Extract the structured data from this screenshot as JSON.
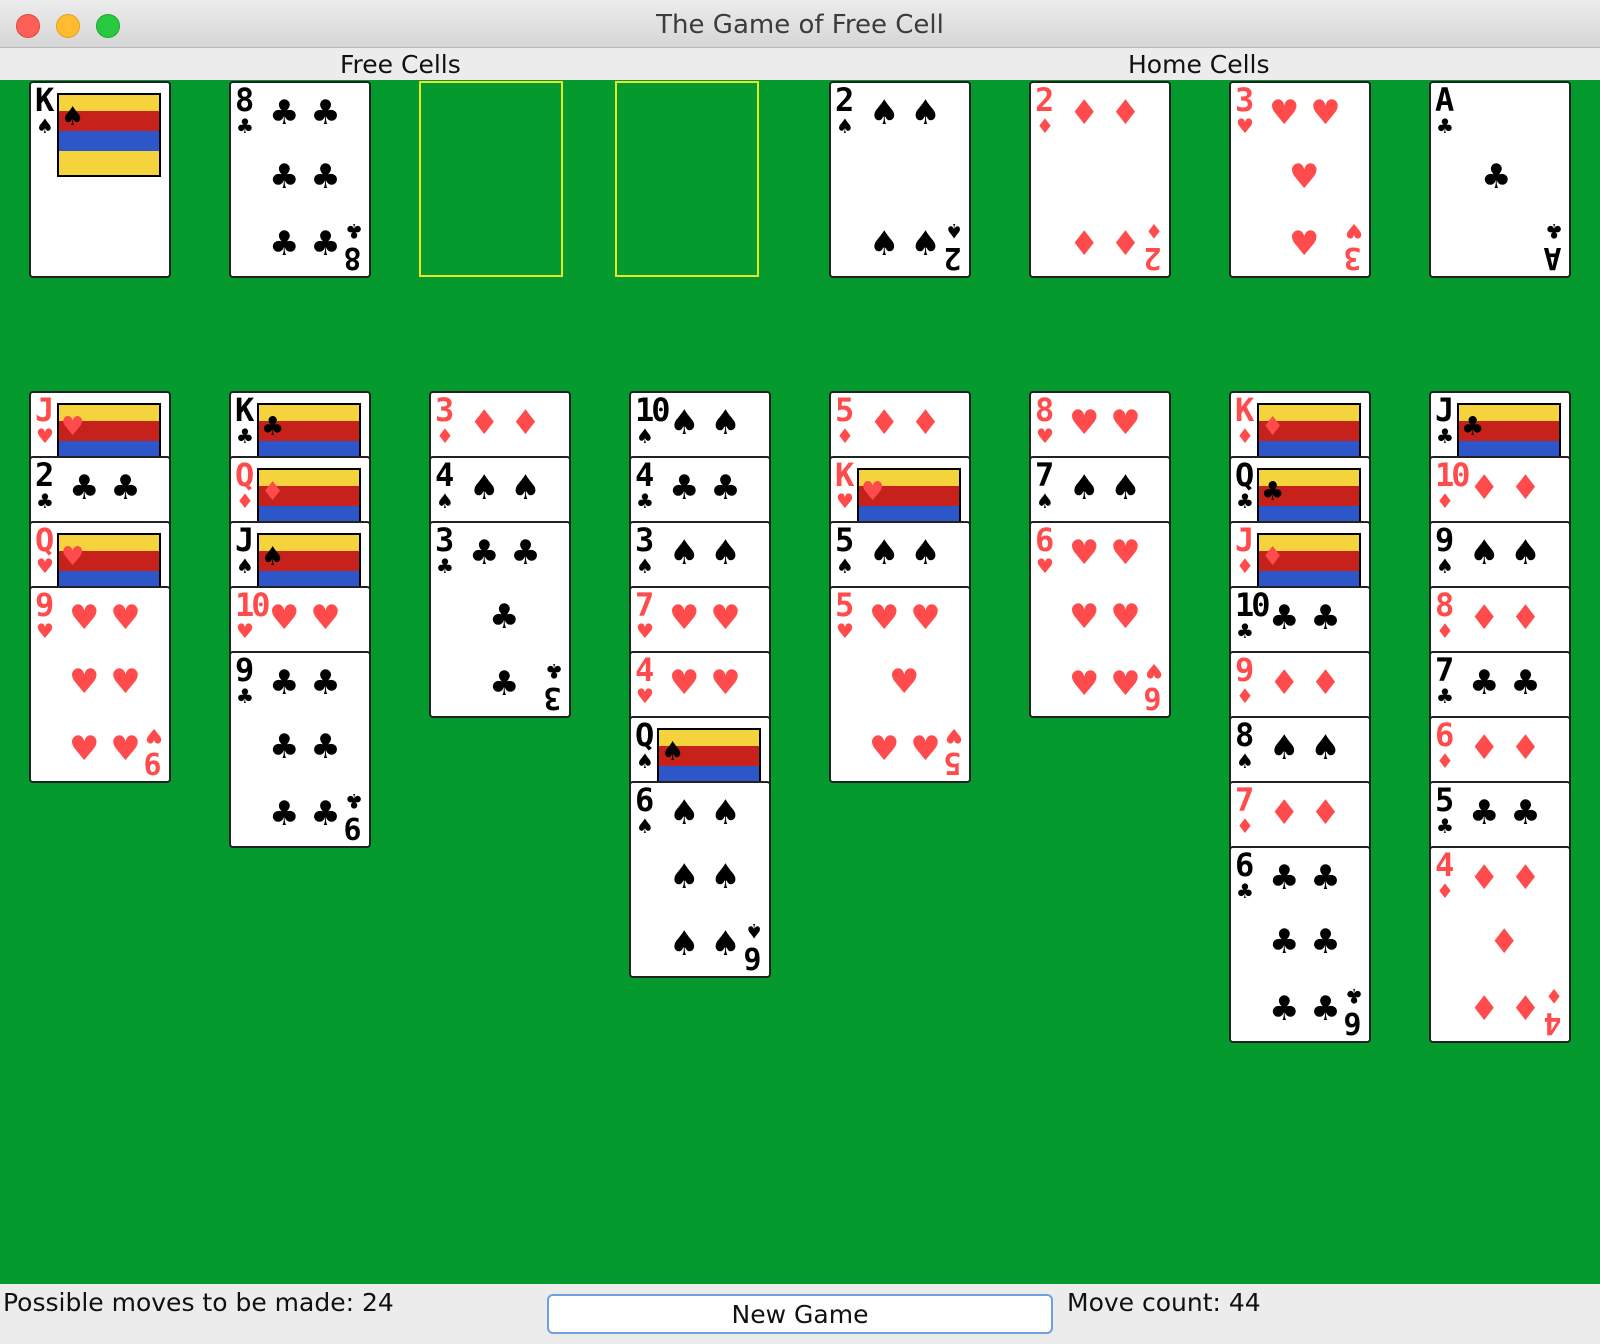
{
  "window": {
    "title": "The Game of Free Cell"
  },
  "headers": {
    "free_cells": "Free Cells",
    "home_cells": "Home Cells"
  },
  "free_cells": [
    {
      "rank": "K",
      "suit": "♠",
      "color": "black"
    },
    {
      "rank": "8",
      "suit": "♣",
      "color": "black"
    },
    null,
    null
  ],
  "home_cells": [
    {
      "rank": "2",
      "suit": "♠",
      "color": "black"
    },
    {
      "rank": "2",
      "suit": "♦",
      "color": "red"
    },
    {
      "rank": "3",
      "suit": "♥",
      "color": "red"
    },
    {
      "rank": "A",
      "suit": "♣",
      "color": "black"
    }
  ],
  "tableau": [
    [
      {
        "rank": "J",
        "suit": "♥",
        "color": "red"
      },
      {
        "rank": "2",
        "suit": "♣",
        "color": "black"
      },
      {
        "rank": "Q",
        "suit": "♥",
        "color": "red"
      },
      {
        "rank": "9",
        "suit": "♥",
        "color": "red"
      }
    ],
    [
      {
        "rank": "K",
        "suit": "♣",
        "color": "black"
      },
      {
        "rank": "Q",
        "suit": "♦",
        "color": "red"
      },
      {
        "rank": "J",
        "suit": "♠",
        "color": "black"
      },
      {
        "rank": "10",
        "suit": "♥",
        "color": "red"
      },
      {
        "rank": "9",
        "suit": "♣",
        "color": "black"
      }
    ],
    [
      {
        "rank": "3",
        "suit": "♦",
        "color": "red"
      },
      {
        "rank": "4",
        "suit": "♠",
        "color": "black"
      },
      {
        "rank": "3",
        "suit": "♣",
        "color": "black"
      }
    ],
    [
      {
        "rank": "10",
        "suit": "♠",
        "color": "black"
      },
      {
        "rank": "4",
        "suit": "♣",
        "color": "black"
      },
      {
        "rank": "3",
        "suit": "♠",
        "color": "black"
      },
      {
        "rank": "7",
        "suit": "♥",
        "color": "red"
      },
      {
        "rank": "4",
        "suit": "♥",
        "color": "red"
      },
      {
        "rank": "Q",
        "suit": "♠",
        "color": "black"
      },
      {
        "rank": "6",
        "suit": "♠",
        "color": "black"
      }
    ],
    [
      {
        "rank": "5",
        "suit": "♦",
        "color": "red"
      },
      {
        "rank": "K",
        "suit": "♥",
        "color": "red"
      },
      {
        "rank": "5",
        "suit": "♠",
        "color": "black"
      },
      {
        "rank": "5",
        "suit": "♥",
        "color": "red"
      }
    ],
    [
      {
        "rank": "8",
        "suit": "♥",
        "color": "red"
      },
      {
        "rank": "7",
        "suit": "♠",
        "color": "black"
      },
      {
        "rank": "6",
        "suit": "♥",
        "color": "red"
      }
    ],
    [
      {
        "rank": "K",
        "suit": "♦",
        "color": "red"
      },
      {
        "rank": "Q",
        "suit": "♣",
        "color": "black"
      },
      {
        "rank": "J",
        "suit": "♦",
        "color": "red"
      },
      {
        "rank": "10",
        "suit": "♣",
        "color": "black"
      },
      {
        "rank": "9",
        "suit": "♦",
        "color": "red"
      },
      {
        "rank": "8",
        "suit": "♠",
        "color": "black"
      },
      {
        "rank": "7",
        "suit": "♦",
        "color": "red"
      },
      {
        "rank": "6",
        "suit": "♣",
        "color": "black"
      }
    ],
    [
      {
        "rank": "J",
        "suit": "♣",
        "color": "black"
      },
      {
        "rank": "10",
        "suit": "♦",
        "color": "red"
      },
      {
        "rank": "9",
        "suit": "♠",
        "color": "black"
      },
      {
        "rank": "8",
        "suit": "♦",
        "color": "red"
      },
      {
        "rank": "7",
        "suit": "♣",
        "color": "black"
      },
      {
        "rank": "6",
        "suit": "♦",
        "color": "red"
      },
      {
        "rank": "5",
        "suit": "♣",
        "color": "black"
      },
      {
        "rank": "4",
        "suit": "♦",
        "color": "red"
      }
    ]
  ],
  "status": {
    "possible_moves": "Possible moves to be made: 24",
    "new_game_label": "New Game",
    "move_count": "Move count: 44"
  },
  "colors": {
    "felt": "#049a2d",
    "red_suit": "#ff4b4b",
    "slot_outline": "#e6e62a"
  }
}
